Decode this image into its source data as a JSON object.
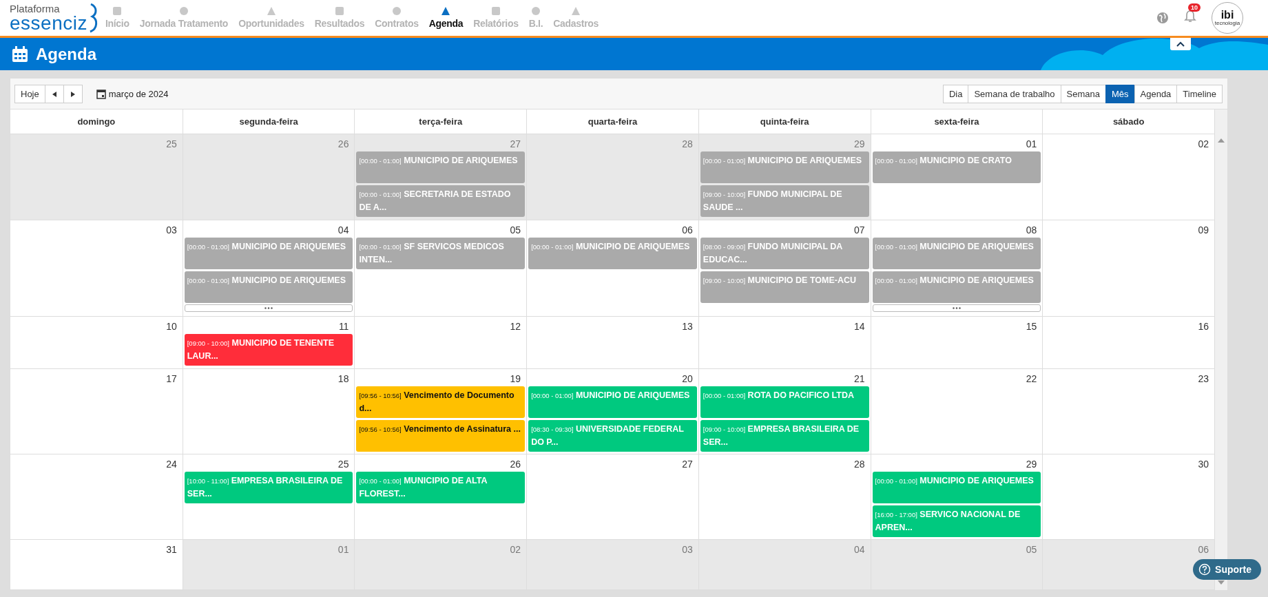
{
  "brand": {
    "small": "Plataforma",
    "large": "essenciz"
  },
  "nav": [
    {
      "label": "Início",
      "selected": false
    },
    {
      "label": "Jornada Tratamento",
      "selected": false
    },
    {
      "label": "Oportunidades",
      "selected": false
    },
    {
      "label": "Resultados",
      "selected": false
    },
    {
      "label": "Contratos",
      "selected": false
    },
    {
      "label": "Agenda",
      "selected": true
    },
    {
      "label": "Relatórios",
      "selected": false
    },
    {
      "label": "B.I.",
      "selected": false
    },
    {
      "label": "Cadastros",
      "selected": false
    }
  ],
  "notifications": {
    "count": "10"
  },
  "company_logo": {
    "text": "ibi",
    "subtext": "tecnologia"
  },
  "page_title": "Agenda",
  "toolbar": {
    "today": "Hoje",
    "period": "março de 2024",
    "views": [
      {
        "label": "Dia",
        "selected": false
      },
      {
        "label": "Semana de trabalho",
        "selected": false
      },
      {
        "label": "Semana",
        "selected": false
      },
      {
        "label": "Mês",
        "selected": true
      },
      {
        "label": "Agenda",
        "selected": false
      },
      {
        "label": "Timeline",
        "selected": false
      }
    ]
  },
  "weekdays": [
    "domingo",
    "segunda-feira",
    "terça-feira",
    "quarta-feira",
    "quinta-feira",
    "sexta-feira",
    "sábado"
  ],
  "weeks": [
    {
      "days": [
        {
          "day": "25",
          "other_month": true
        },
        {
          "day": "26",
          "other_month": true
        },
        {
          "day": "27",
          "other_month": true,
          "events": [
            {
              "time": "[00:00 - 01:00]",
              "title": "MUNICIPIO DE ARIQUEMES",
              "color": "#aaaaaa"
            },
            {
              "time": "[00:00 - 01:00]",
              "title": "SECRETARIA DE ESTADO DE A...",
              "color": "#aaaaaa"
            }
          ]
        },
        {
          "day": "28",
          "other_month": true
        },
        {
          "day": "29",
          "other_month": true,
          "events": [
            {
              "time": "[00:00 - 01:00]",
              "title": "MUNICIPIO DE ARIQUEMES",
              "color": "#aaaaaa"
            },
            {
              "time": "[09:00 - 10:00]",
              "title": "FUNDO MUNICIPAL DE SAUDE ...",
              "color": "#aaaaaa"
            }
          ]
        },
        {
          "day": "01",
          "other_month": false,
          "events": [
            {
              "time": "[00:00 - 01:00]",
              "title": "MUNICIPIO DE CRATO",
              "color": "#aaaaaa"
            }
          ]
        },
        {
          "day": "02",
          "other_month": false
        }
      ]
    },
    {
      "days": [
        {
          "day": "03",
          "other_month": false
        },
        {
          "day": "04",
          "other_month": false,
          "more": true,
          "events": [
            {
              "time": "[00:00 - 01:00]",
              "title": "MUNICIPIO DE ARIQUEMES",
              "color": "#aaaaaa"
            },
            {
              "time": "[00:00 - 01:00]",
              "title": "MUNICIPIO DE ARIQUEMES",
              "color": "#aaaaaa"
            }
          ]
        },
        {
          "day": "05",
          "other_month": false,
          "events": [
            {
              "time": "[00:00 - 01:00]",
              "title": "SF SERVICOS MEDICOS INTEN...",
              "color": "#aaaaaa"
            }
          ]
        },
        {
          "day": "06",
          "other_month": false,
          "events": [
            {
              "time": "[00:00 - 01:00]",
              "title": "MUNICIPIO DE ARIQUEMES",
              "color": "#aaaaaa"
            }
          ]
        },
        {
          "day": "07",
          "other_month": false,
          "events": [
            {
              "time": "[08:00 - 09:00]",
              "title": "FUNDO MUNICIPAL DA EDUCAC...",
              "color": "#aaaaaa"
            },
            {
              "time": "[09:00 - 10:00]",
              "title": "MUNICIPIO DE TOME-ACU",
              "color": "#aaaaaa"
            }
          ]
        },
        {
          "day": "08",
          "other_month": false,
          "more": true,
          "events": [
            {
              "time": "[00:00 - 01:00]",
              "title": "MUNICIPIO DE ARIQUEMES",
              "color": "#aaaaaa"
            },
            {
              "time": "[00:00 - 01:00]",
              "title": "MUNICIPIO DE ARIQUEMES",
              "color": "#aaaaaa"
            }
          ]
        },
        {
          "day": "09",
          "other_month": false
        }
      ]
    },
    {
      "days": [
        {
          "day": "10",
          "other_month": false
        },
        {
          "day": "11",
          "other_month": false,
          "events": [
            {
              "time": "[09:00 - 10:00]",
              "title": "MUNICIPIO DE TENENTE LAUR...",
              "color": "#ff2d3a"
            }
          ]
        },
        {
          "day": "12",
          "other_month": false
        },
        {
          "day": "13",
          "other_month": false
        },
        {
          "day": "14",
          "other_month": false
        },
        {
          "day": "15",
          "other_month": false
        },
        {
          "day": "16",
          "other_month": false
        }
      ]
    },
    {
      "days": [
        {
          "day": "17",
          "other_month": false
        },
        {
          "day": "18",
          "other_month": false
        },
        {
          "day": "19",
          "other_month": false,
          "events": [
            {
              "time": "[09:56 - 10:56]",
              "title": "Vencimento de Documento d...",
              "color": "#ffc000"
            },
            {
              "time": "[09:56 - 10:56]",
              "title": "Vencimento de Assinatura ...",
              "color": "#ffc000"
            }
          ]
        },
        {
          "day": "20",
          "other_month": false,
          "events": [
            {
              "time": "[00:00 - 01:00]",
              "title": "MUNICIPIO DE ARIQUEMES",
              "color": "#00c97f"
            },
            {
              "time": "[08:30 - 09:30]",
              "title": "UNIVERSIDADE FEDERAL DO P...",
              "color": "#00c97f"
            }
          ]
        },
        {
          "day": "21",
          "other_month": false,
          "events": [
            {
              "time": "[00:00 - 01:00]",
              "title": "ROTA DO PACIFICO LTDA",
              "color": "#00c97f"
            },
            {
              "time": "[09:00 - 10:00]",
              "title": "EMPRESA BRASILEIRA DE SER...",
              "color": "#00c97f"
            }
          ]
        },
        {
          "day": "22",
          "other_month": false
        },
        {
          "day": "23",
          "other_month": false
        }
      ]
    },
    {
      "days": [
        {
          "day": "24",
          "other_month": false
        },
        {
          "day": "25",
          "other_month": false,
          "events": [
            {
              "time": "[10:00 - 11:00]",
              "title": "EMPRESA BRASILEIRA DE SER...",
              "color": "#00c97f"
            }
          ]
        },
        {
          "day": "26",
          "other_month": false,
          "events": [
            {
              "time": "[00:00 - 01:00]",
              "title": "MUNICIPIO DE ALTA FLOREST...",
              "color": "#00c97f"
            }
          ]
        },
        {
          "day": "27",
          "other_month": false
        },
        {
          "day": "28",
          "other_month": false
        },
        {
          "day": "29",
          "other_month": false,
          "events": [
            {
              "time": "[00:00 - 01:00]",
              "title": "MUNICIPIO DE ARIQUEMES",
              "color": "#00c97f"
            },
            {
              "time": "[16:00 - 17:00]",
              "title": "SERVICO NACIONAL DE APREN...",
              "color": "#00c97f"
            }
          ]
        },
        {
          "day": "30",
          "other_month": false
        }
      ]
    },
    {
      "days": [
        {
          "day": "31",
          "other_month": false
        },
        {
          "day": "01",
          "other_month": true
        },
        {
          "day": "02",
          "other_month": true
        },
        {
          "day": "03",
          "other_month": true
        },
        {
          "day": "04",
          "other_month": true
        },
        {
          "day": "05",
          "other_month": true
        },
        {
          "day": "06",
          "other_month": true
        }
      ]
    }
  ],
  "support": {
    "label": "Suporte"
  }
}
